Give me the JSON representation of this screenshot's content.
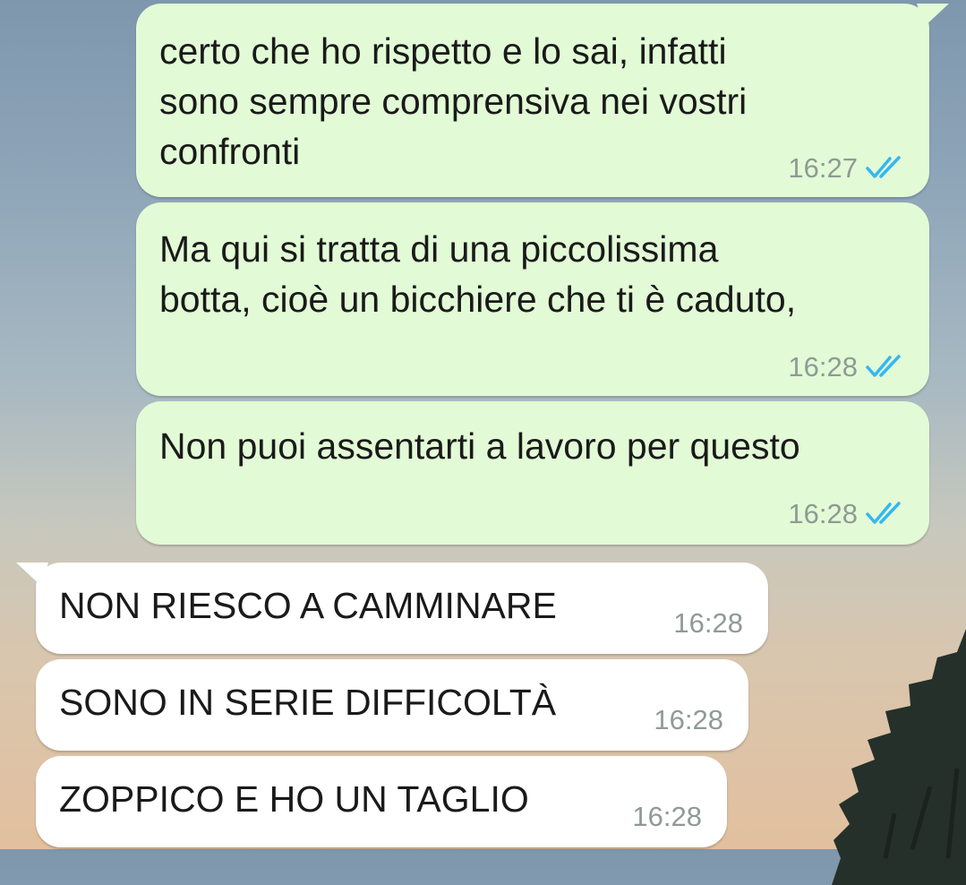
{
  "chat": {
    "outgoing": [
      {
        "text": "certo che ho rispetto e lo sai, infatti\nsono sempre comprensiva nei vostri\nconfronti",
        "time": "16:27",
        "status_icon": "double-check-read-icon"
      },
      {
        "text": "Ma qui si tratta di una piccolissima\nbotta, cioè un bicchiere che ti è caduto,",
        "time": "16:28",
        "status_icon": "double-check-read-icon"
      },
      {
        "text": "Non puoi assentarti a lavoro per questo",
        "time": "16:28",
        "status_icon": "double-check-read-icon"
      }
    ],
    "incoming": [
      {
        "text": "NON RIESCO A CAMMINARE",
        "time": "16:28"
      },
      {
        "text": "SONO IN SERIE DIFFICOLTÀ",
        "time": "16:28"
      },
      {
        "text": "ZOPPICO E HO UN TAGLIO",
        "time": "16:28"
      }
    ]
  },
  "colors": {
    "outgoing_bubble": "#e2fbd6",
    "incoming_bubble": "#ffffff",
    "read_check": "#34b7f1",
    "time_text": "#8f9a95"
  }
}
